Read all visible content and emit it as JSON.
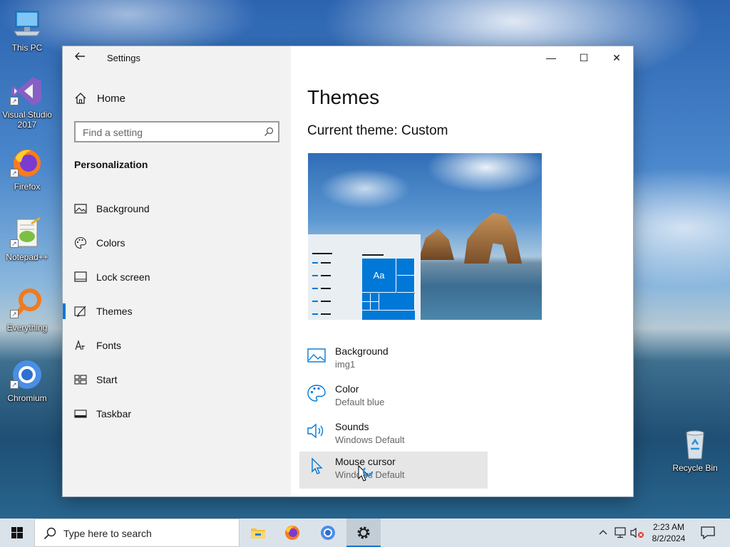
{
  "desktop": {
    "icons": [
      {
        "label": "This PC",
        "icon": "computer-icon"
      },
      {
        "label": "Visual Studio 2017",
        "icon": "visual-studio-icon"
      },
      {
        "label": "Firefox",
        "icon": "firefox-icon"
      },
      {
        "label": "Notepad++",
        "icon": "notepad-plus-plus-icon"
      },
      {
        "label": "Everything",
        "icon": "everything-search-icon"
      },
      {
        "label": "Chromium",
        "icon": "chromium-icon"
      },
      {
        "label": "Recycle Bin",
        "icon": "recycle-bin-icon"
      }
    ]
  },
  "window": {
    "title": "Settings",
    "back_icon": "back-arrow-icon",
    "caption_buttons": {
      "minimize": "—",
      "maximize": "☐",
      "close": "✕"
    }
  },
  "sidebar": {
    "home_label": "Home",
    "search_placeholder": "Find a setting",
    "section_title": "Personalization",
    "items": [
      {
        "label": "Background",
        "icon": "picture-icon",
        "active": false
      },
      {
        "label": "Colors",
        "icon": "palette-icon",
        "active": false
      },
      {
        "label": "Lock screen",
        "icon": "lock-screen-icon",
        "active": false
      },
      {
        "label": "Themes",
        "icon": "brush-icon",
        "active": true
      },
      {
        "label": "Fonts",
        "icon": "fonts-icon",
        "active": false
      },
      {
        "label": "Start",
        "icon": "start-icon",
        "active": false
      },
      {
        "label": "Taskbar",
        "icon": "taskbar-icon",
        "active": false
      }
    ]
  },
  "main": {
    "page_title": "Themes",
    "current_theme": "Current theme: Custom",
    "preview_tile_text": "Aa",
    "options": [
      {
        "title": "Background",
        "value": "img1",
        "icon": "picture-icon"
      },
      {
        "title": "Color",
        "value": "Default blue",
        "icon": "palette-icon"
      },
      {
        "title": "Sounds",
        "value": "Windows Default",
        "icon": "speaker-icon"
      },
      {
        "title": "Mouse cursor",
        "value": "Windows Default",
        "icon": "cursor-icon"
      }
    ]
  },
  "taskbar": {
    "search_placeholder": "Type here to search",
    "apps": [
      "file-explorer-icon",
      "firefox-icon",
      "chromium-icon",
      "settings-gear-icon"
    ],
    "time": "2:23 AM",
    "date": "8/2/2024"
  },
  "colors": {
    "accent": "#0078d7",
    "sidebar_bg": "#f2f2f2",
    "taskbar_bg": "#dbe3ea"
  }
}
